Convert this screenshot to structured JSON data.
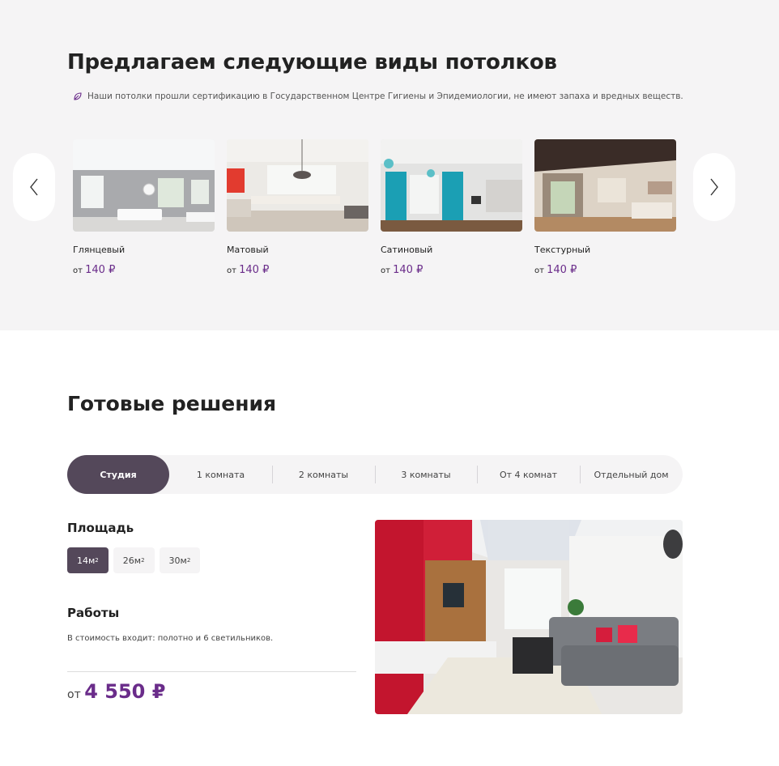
{
  "ceilings": {
    "heading": "Предлагаем следующие виды потолков",
    "note": "Наши потолки прошли сертификацию в Государственном Центре Гигиены и Эпидемиологии, не имеют запаха и вредных веществ.",
    "items": [
      {
        "title": "Глянцевый",
        "price_prefix": "от",
        "price": "140 ₽"
      },
      {
        "title": "Матовый",
        "price_prefix": "от",
        "price": "140 ₽"
      },
      {
        "title": "Сатиновый",
        "price_prefix": "от",
        "price": "140 ₽"
      },
      {
        "title": "Текстурный",
        "price_prefix": "от",
        "price": "140 ₽"
      }
    ],
    "prev_icon": "chevron-left-icon",
    "next_icon": "chevron-right-icon"
  },
  "solutions": {
    "heading": "Готовые решения",
    "tabs": [
      "Студия",
      "1 комната",
      "2 комнаты",
      "3 комнаты",
      "От 4 комнат",
      "Отдельный дом"
    ],
    "active_tab": "Студия",
    "area_label": "Площадь",
    "areas": [
      {
        "value": "14м",
        "sup": "2"
      },
      {
        "value": "26м",
        "sup": "2"
      },
      {
        "value": "30м",
        "sup": "2"
      }
    ],
    "active_area": "14м2",
    "works_label": "Работы",
    "works_text": "В стоимость входит: полотно и 6 светильников.",
    "total_prefix": "от",
    "total_price": "4 550 ₽"
  },
  "colors": {
    "accent": "#6a2c8a",
    "active_bg": "#54485a",
    "section_bg": "#f5f4f5"
  }
}
